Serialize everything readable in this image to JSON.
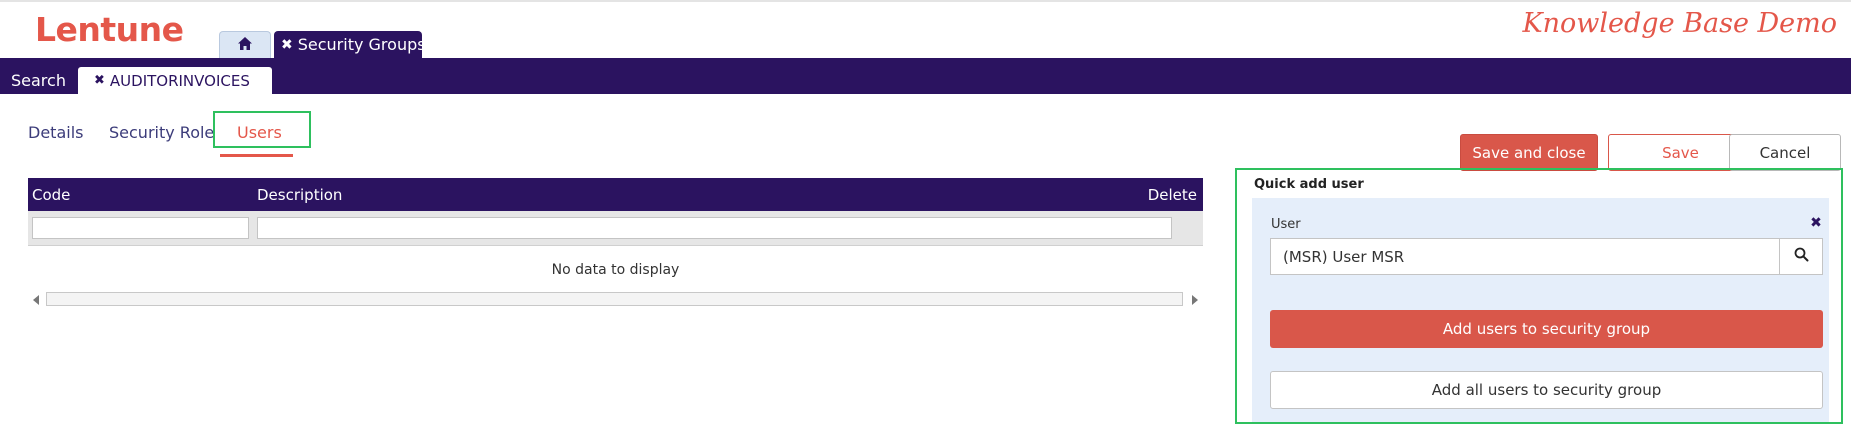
{
  "app": {
    "logo": "Lentune",
    "tagline": "Knowledge Base Demo"
  },
  "top_tabs": {
    "home_icon": "home-icon",
    "active_label": "Security Groups",
    "close_glyph": "✖"
  },
  "nav": {
    "search_label": "Search",
    "record_tab_label": "AUDITORINVOICES",
    "close_glyph": "✖"
  },
  "sub_tabs": [
    {
      "label": "Details"
    },
    {
      "label": "Security Role"
    },
    {
      "label": "Users",
      "active": true
    }
  ],
  "toolbar": {
    "save_close_label": "Save and close",
    "save_label": "Save",
    "cancel_label": "Cancel"
  },
  "grid": {
    "columns": [
      "Code",
      "Description",
      "Delete"
    ],
    "empty_message": "No data to display"
  },
  "quick_add": {
    "title": "Quick add user",
    "user_label": "User",
    "user_value": "(MSR) User MSR",
    "clear_glyph": "✖",
    "add_label": "Add users to security group",
    "add_all_label": "Add all users to security group"
  },
  "colors": {
    "brand": "#e4574a",
    "nav": "#2b1360",
    "highlight": "#2ec05e",
    "panel": "#e5eefa"
  }
}
